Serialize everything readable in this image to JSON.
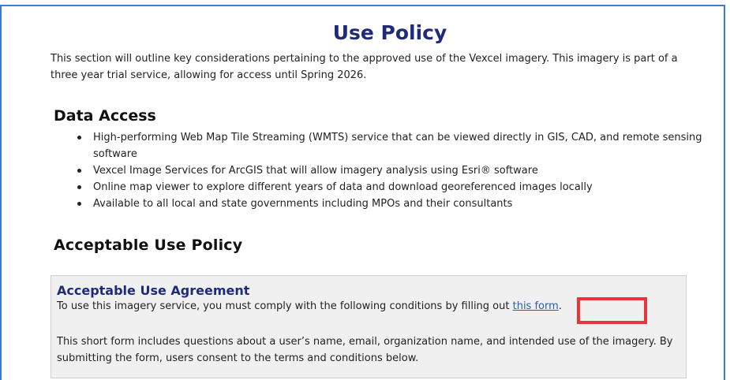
{
  "header": {
    "title": "Use Policy",
    "intro": "This section will outline key considerations pertaining to the approved use of the Vexcel imagery. This imagery is part of a three year trial service, allowing for access until Spring 2026."
  },
  "data_access": {
    "heading": "Data Access",
    "items": [
      "High-performing Web Map Tile Streaming (WMTS) service that can be viewed directly in GIS, CAD, and remote sensing software",
      "Vexcel Image Services for ArcGIS that will allow imagery analysis using Esri® software",
      "Online map viewer to explore different years of data and download georeferenced images locally",
      "Available to all local and state governments including MPOs and their consultants"
    ]
  },
  "acceptable_use": {
    "heading": "Acceptable Use Policy",
    "agreement": {
      "title": "Acceptable Use Agreement",
      "line_prefix": "To use this imagery service, you must comply with the following conditions by filling out ",
      "link_text": "this form",
      "line_suffix": ".",
      "paragraph": "This short form includes questions about a user’s name, email, organization name, and intended use of the imagery. By submitting the form, users consent to the terms and conditions below."
    }
  },
  "colors": {
    "title": "#1f2b7a",
    "link": "#2a5db0",
    "highlight": "#e8343a",
    "frame": "#3b7bd1"
  }
}
